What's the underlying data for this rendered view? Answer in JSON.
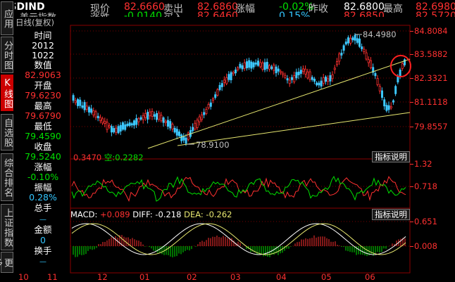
{
  "header": {
    "symbol": "USDIND",
    "subtitle": "美元指数",
    "row1": [
      {
        "label": "现价",
        "value": "82.6660"
      },
      {
        "label": "卖出",
        "value": "82.6860"
      },
      {
        "label": "涨幅",
        "value": "-0.02%"
      },
      {
        "label": "昨收",
        "value": "82.6800"
      },
      {
        "label": "最高",
        "value": "82.6980"
      }
    ],
    "row2_partial": [
      "涨跌",
      "-0.0140",
      "买入",
      "82.6460",
      "0.15%",
      "82.6850",
      "82.5720"
    ]
  },
  "chart_mode": "日线(复权)",
  "nav": {
    "items": [
      "应用",
      "分时图",
      "K线图",
      "自选股",
      "综合排名",
      "上证指数",
      "更多"
    ],
    "active_index": 2
  },
  "info_panel": [
    {
      "label": "时间",
      "value": "2012"
    },
    {
      "label": "",
      "value": "1022"
    },
    {
      "label": "数值",
      "value": "82.9063"
    },
    {
      "label": "开盘",
      "value": "79.6230"
    },
    {
      "label": "最高",
      "value": "79.6790"
    },
    {
      "label": "最低",
      "value": "79.4590"
    },
    {
      "label": "收盘",
      "value": "79.5240"
    },
    {
      "label": "涨幅",
      "value": "-0.10%"
    },
    {
      "label": "振幅",
      "value": "0.28%"
    },
    {
      "label": "总手",
      "value": "—"
    },
    {
      "label": "金额",
      "value": "0"
    },
    {
      "label": "换手",
      "value": "—"
    }
  ],
  "main_chart": {
    "y_ticks": [
      "84.8084",
      "83.5882",
      "82.3321",
      "81.1118",
      "79.8557"
    ],
    "high_annotation": "84.4980",
    "low_annotation": "78.9100"
  },
  "indicator1": {
    "title_left": "0.3470",
    "title_mid_label": "空:",
    "title_mid_value": "0.2282",
    "button": "指标说明",
    "y_ticks": [
      "1.32",
      "0.718"
    ]
  },
  "indicator2": {
    "macd_label": "MACD:",
    "macd_value": "+0.089",
    "diff_label": "DIFF:",
    "diff_value": "-0.218",
    "dea_label": "DEA:",
    "dea_value": "-0.262",
    "button": "指标说明",
    "y_ticks": [
      "0.651",
      "0.008"
    ]
  },
  "x_axis": [
    "10",
    "11",
    "12",
    "01",
    "02",
    "03",
    "04",
    "05",
    "06"
  ],
  "colors": {
    "up": "#ff3030",
    "down": "#00e000",
    "grid": "#6a0000",
    "trend": "#e8e870",
    "cyan": "#33c6ff"
  }
}
